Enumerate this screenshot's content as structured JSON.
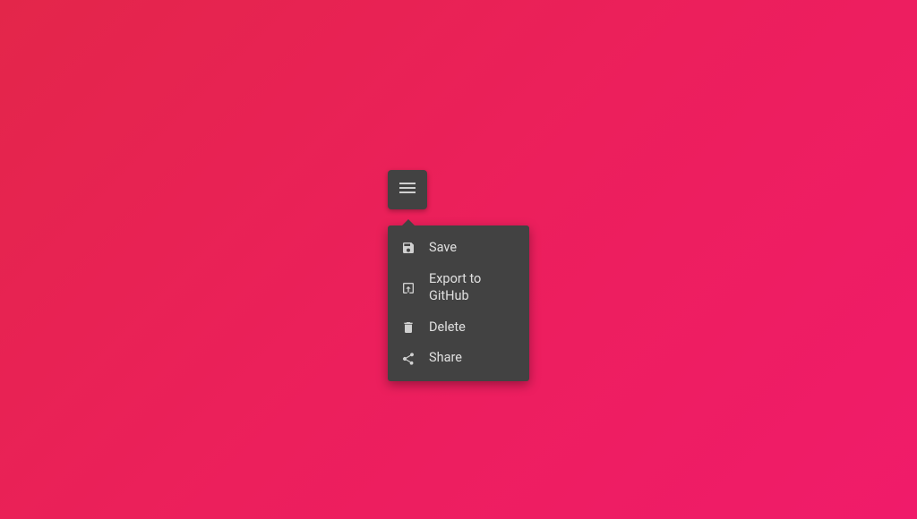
{
  "menu": {
    "items": [
      {
        "icon": "save-icon",
        "label": "Save"
      },
      {
        "icon": "export-icon",
        "label": "Export to GitHub"
      },
      {
        "icon": "delete-icon",
        "label": "Delete"
      },
      {
        "icon": "share-icon",
        "label": "Share"
      }
    ]
  }
}
